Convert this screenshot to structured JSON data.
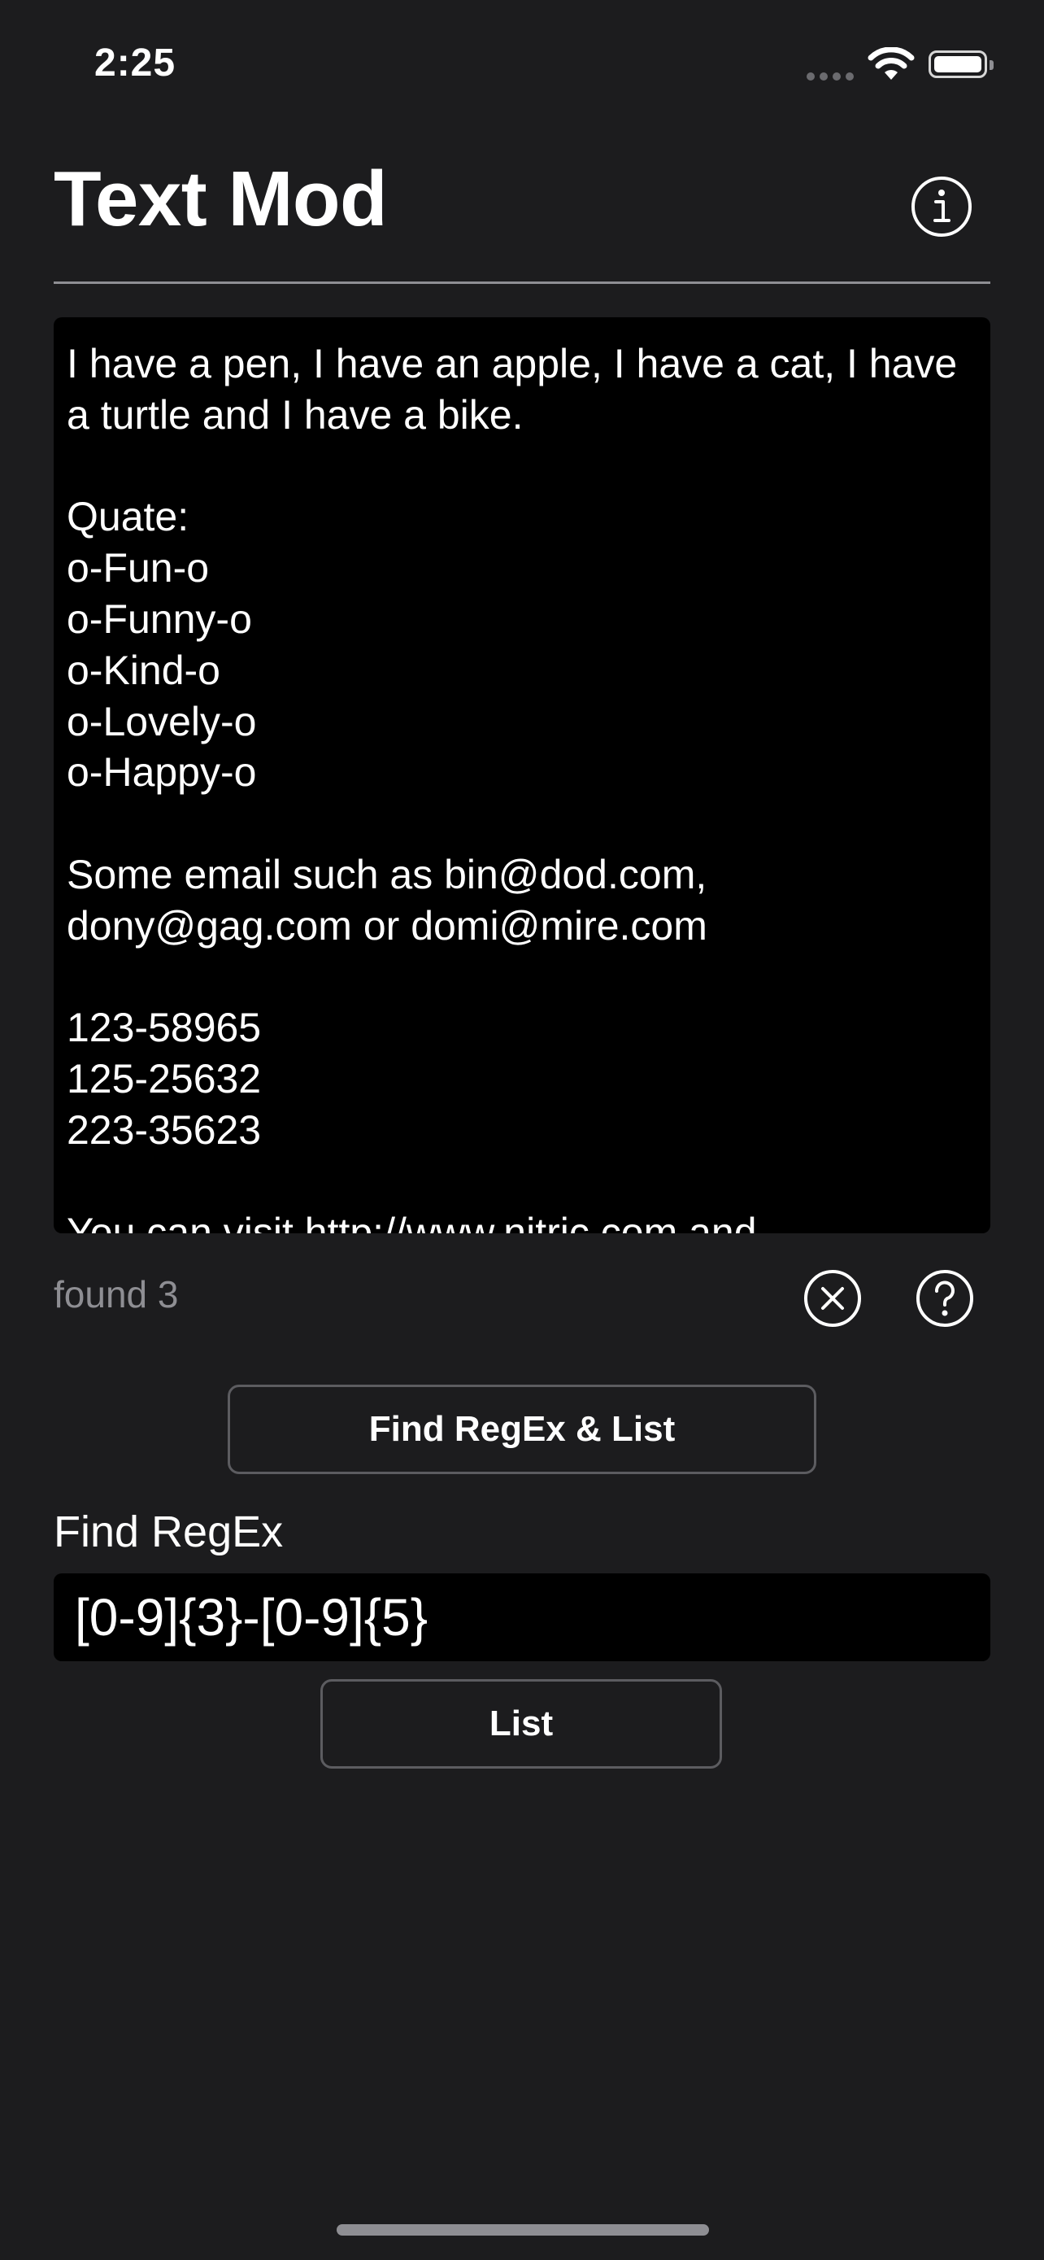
{
  "status_bar": {
    "time": "2:25",
    "icons": [
      "signal-dots-icon",
      "wifi-icon",
      "battery-icon"
    ]
  },
  "header": {
    "title": "Text Mod",
    "info_icon": "info-circle-icon"
  },
  "editor": {
    "text": "I have a pen, I have an apple, I have a cat, I have a turtle and I have a bike.\n\nQuate:\no-Fun-o\no-Funny-o\no-Kind-o\no-Lovely-o\no-Happy-o\n\nSome email such as bin@dod.com, dony@gag.com or domi@mire.com\n\n123-58965\n125-25632\n223-35623\n\nYou can visit http://www.nitric.com and"
  },
  "result": {
    "found_text": "found 3",
    "clear_icon": "clear-circle-icon",
    "help_icon": "help-circle-icon"
  },
  "actions": {
    "find_list_label": "Find RegEx & List",
    "regex_label": "Find RegEx",
    "regex_value": "[0-9]{3}-[0-9]{5}",
    "list_label": "List"
  },
  "colors": {
    "background": "#1c1c1e",
    "field_background": "#000000",
    "secondary_text": "#8e8e93",
    "border": "#5c5c60"
  }
}
